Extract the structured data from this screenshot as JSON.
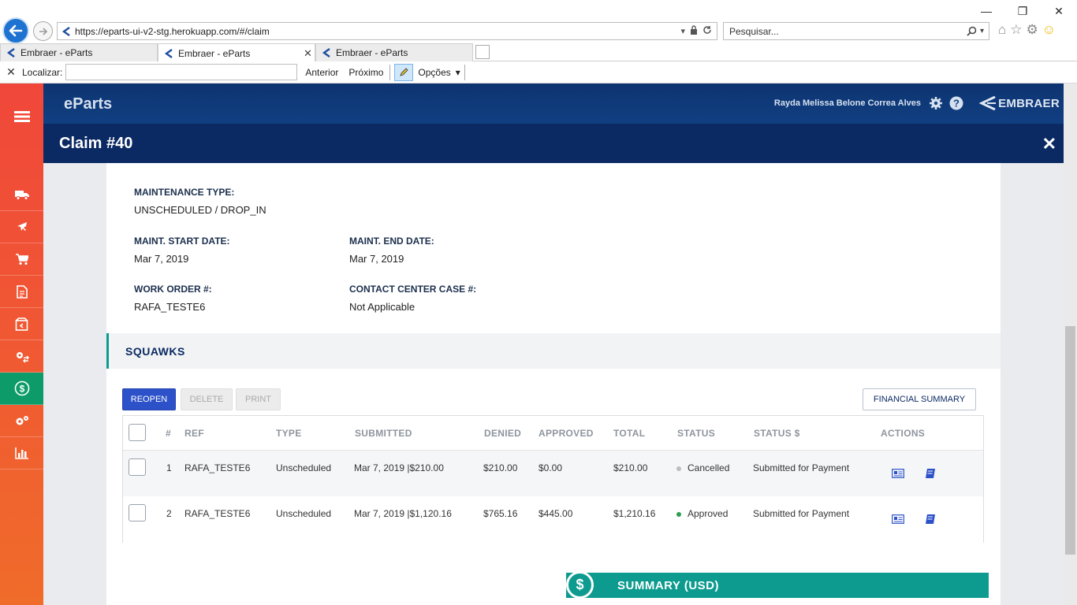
{
  "browser": {
    "url": "https://eparts-ui-v2-stg.herokuapp.com/#/claim",
    "search_placeholder": "Pesquisar...",
    "tabs": [
      {
        "label": "Embraer - eParts"
      },
      {
        "label": "Embraer - eParts"
      },
      {
        "label": "Embraer - eParts"
      }
    ],
    "find": {
      "label": "Localizar:",
      "value": "",
      "prev": "Anterior",
      "next": "Próximo",
      "options": "Opções"
    }
  },
  "app": {
    "brand": "eParts",
    "user": "Rayda Melissa Belone Correa Alves",
    "logo_text": "EMBRAER",
    "claim_title": "Claim #40",
    "fields": {
      "maintenance_type_label": "MAINTENANCE TYPE:",
      "maintenance_type_value": "UNSCHEDULED / DROP_IN",
      "start_label": "MAINT. START DATE:",
      "start_value": "Mar 7, 2019",
      "end_label": "MAINT. END DATE:",
      "end_value": "Mar 7, 2019",
      "wo_label": "WORK ORDER #:",
      "wo_value": "RAFA_TESTE6",
      "ccc_label": "CONTACT CENTER CASE #:",
      "ccc_value": "Not Applicable"
    },
    "squawks_title": "SQUAWKS",
    "buttons": {
      "reopen": "REOPEN",
      "delete": "DELETE",
      "print": "PRINT",
      "financial_summary": "FINANCIAL SUMMARY"
    },
    "table": {
      "headers": [
        "#",
        "REF",
        "TYPE",
        "SUBMITTED",
        "DENIED",
        "APPROVED",
        "TOTAL",
        "STATUS",
        "STATUS $",
        "ACTIONS"
      ],
      "rows": [
        {
          "num": "1",
          "ref": "RAFA_TESTE6",
          "type": "Unscheduled",
          "submitted": "Mar 7, 2019 |$210.00",
          "denied": "$210.00",
          "approved": "$0.00",
          "total": "$210.00",
          "status": "Cancelled",
          "status_dollar": "Submitted for Payment",
          "status_color": "#bdbdbd"
        },
        {
          "num": "2",
          "ref": "RAFA_TESTE6",
          "type": "Unscheduled",
          "submitted": "Mar 7, 2019 |$1,120.16",
          "denied": "$765.16",
          "approved": "$445.00",
          "total": "$1,210.16",
          "status": "Approved",
          "status_dollar": "Submitted for Payment",
          "status_color": "#2e9e4f"
        }
      ]
    },
    "summary": {
      "icon": "$",
      "title": "SUMMARY (USD)"
    }
  }
}
